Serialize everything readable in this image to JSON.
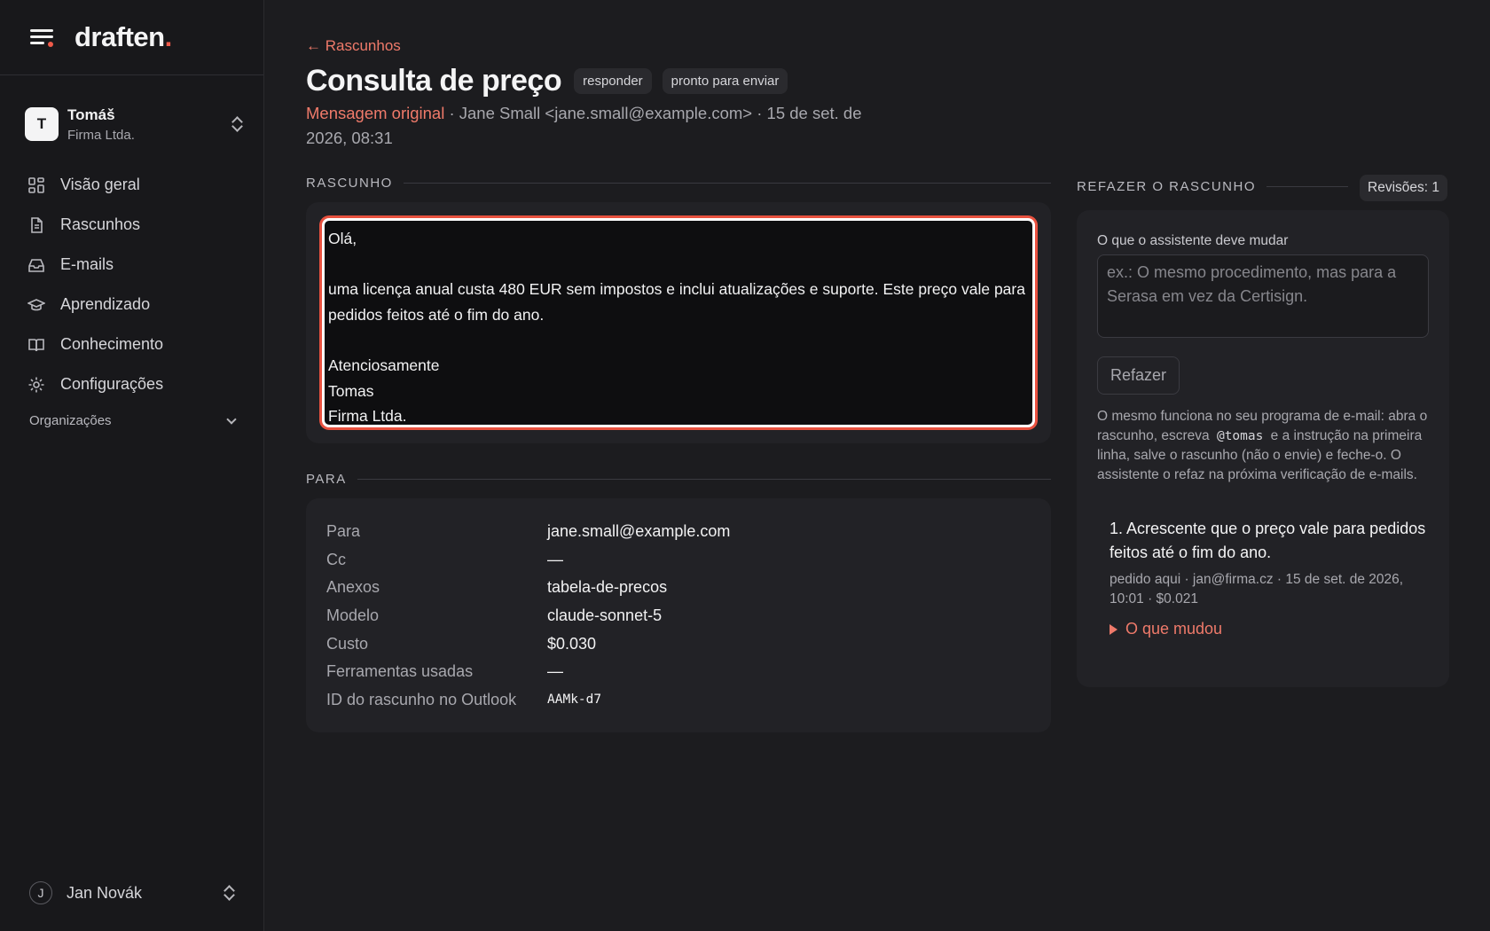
{
  "brand": {
    "name": "draften",
    "dot": "."
  },
  "account": {
    "initial": "T",
    "name": "Tomáš",
    "org": "Firma Ltda."
  },
  "nav": [
    {
      "label": "Visão geral",
      "icon": "grid-icon"
    },
    {
      "label": "Rascunhos",
      "icon": "document-icon"
    },
    {
      "label": "E-mails",
      "icon": "inbox-icon"
    },
    {
      "label": "Aprendizado",
      "icon": "graduation-cap-icon"
    },
    {
      "label": "Conhecimento",
      "icon": "book-icon"
    },
    {
      "label": "Configurações",
      "icon": "gear-icon"
    }
  ],
  "orgs_label": "Organizações",
  "user": {
    "initial": "J",
    "name": "Jan Novák"
  },
  "back_label": "← Rascunhos",
  "title": "Consulta de preço",
  "badges": [
    "responder",
    "pronto para enviar"
  ],
  "meta": {
    "original_link": "Mensagem original",
    "rest": " · Jane Small <jane.small@example.com> · 15 de set. de 2026, 08:31"
  },
  "draft_section": "RASCUNHO",
  "draft_text": "Olá,\n\numa licença anual custa 480 EUR sem impostos e inclui atualizações e suporte. Este preço vale para pedidos feitos até o fim do ano.\n\nAtenciosamente\nTomas\nFirma Ltda.",
  "to_section": "PARA",
  "fields": [
    {
      "key": "Para",
      "value": "jane.small@example.com"
    },
    {
      "key": "Cc",
      "value": "—"
    },
    {
      "key": "Anexos",
      "value": "tabela-de-precos"
    },
    {
      "key": "Modelo",
      "value": "claude-sonnet-5"
    },
    {
      "key": "Custo",
      "value": "$0.030"
    },
    {
      "key": "Ferramentas usadas",
      "value": "—"
    },
    {
      "key": "ID do rascunho no Outlook",
      "value": "AAMk-d7"
    }
  ],
  "redo": {
    "section": "REFAZER O RASCUNHO",
    "revisions": "Revisões: 1",
    "label": "O que o assistente deve mudar",
    "placeholder": "ex.: O mesmo procedimento, mas para a Serasa em vez da Certisign.",
    "button": "Refazer",
    "help_before": "O mesmo funciona no seu programa de e-mail: abra o rascunho, escreva",
    "help_code": "@tomas",
    "help_after": "e a instrução na primeira linha, salve o rascunho (não o envie) e feche-o. O assistente o refaz na próxima verificação de e-mails.",
    "revision_item": {
      "title": "1. Acrescente que o preço vale para pedidos feitos até o fim do ano.",
      "meta": "pedido aqui · jan@firma.cz · 15 de set. de 2026, 10:01 · $0.021",
      "toggle": "O que mudou"
    }
  },
  "colors": {
    "accent": "#ef5a4a",
    "link": "#ef7a6a",
    "bg": "#1c1c1f",
    "card": "#222226"
  }
}
